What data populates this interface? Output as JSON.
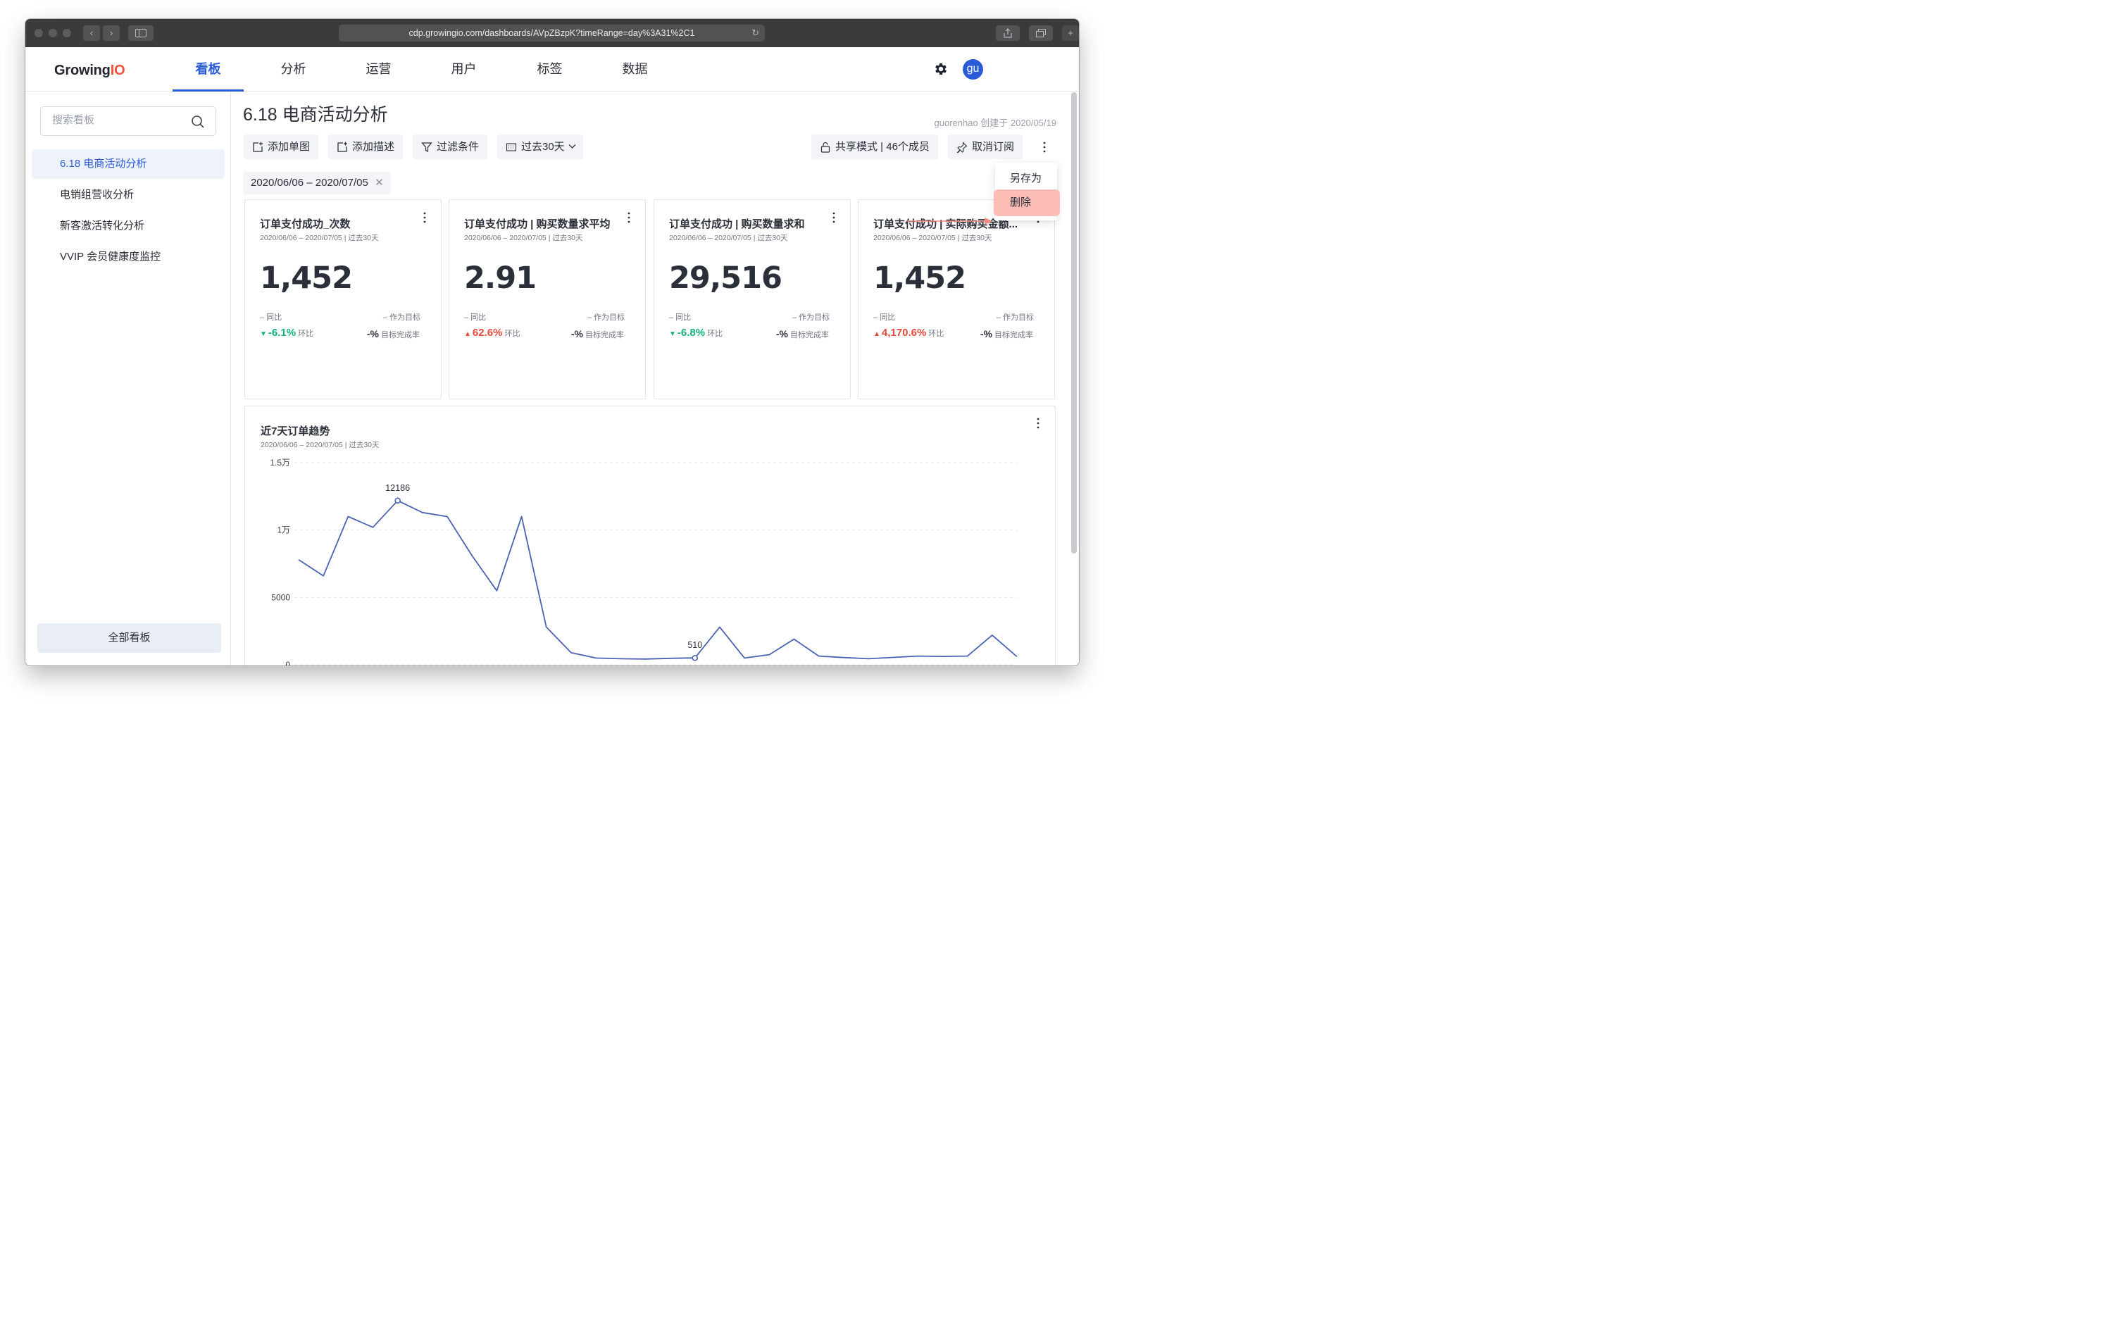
{
  "browser": {
    "url": "cdp.growingio.com/dashboards/AVpZBzpK?timeRange=day%3A31%2C1"
  },
  "header": {
    "logo_main": "Growing",
    "logo_accent": "IO",
    "nav": [
      {
        "label": "看板",
        "active": true
      },
      {
        "label": "分析",
        "active": false
      },
      {
        "label": "运营",
        "active": false
      },
      {
        "label": "用户",
        "active": false
      },
      {
        "label": "标签",
        "active": false
      },
      {
        "label": "数据",
        "active": false
      }
    ],
    "avatar_text": "gu",
    "accent_color": "#2a5bd7"
  },
  "sidebar": {
    "search_placeholder": "搜索看板",
    "items": [
      {
        "label": "6.18 电商活动分析",
        "active": true
      },
      {
        "label": "电销组营收分析",
        "active": false
      },
      {
        "label": "新客激活转化分析",
        "active": false
      },
      {
        "label": "VVIP 会员健康度监控",
        "active": false
      }
    ],
    "all_boards_label": "全部看板"
  },
  "dashboard": {
    "title": "6.18 电商活动分析",
    "creator": "guorenhao 创建于 2020/05/19",
    "toolbar": {
      "add_chart": "添加单图",
      "add_desc": "添加描述",
      "filter": "过滤条件",
      "time_range": "过去30天",
      "share_mode": "共享模式 | 46个成员",
      "unsubscribe": "取消订阅"
    },
    "date_chip": "2020/06/06 – 2020/07/05",
    "menu": {
      "save_as": "另存为",
      "delete": "删除"
    }
  },
  "cards": [
    {
      "title": "订单支付成功_次数",
      "range": "2020/06/06 – 2020/07/05 | 过去30天",
      "value": "1,452",
      "yoy": "– 同比",
      "goal": "– 作为目标",
      "mom_pct": "-6.1%",
      "mom_dir": "down",
      "mom_label": "环比",
      "rate": "-%",
      "rate_label": "目标完成率"
    },
    {
      "title": "订单支付成功 | 购买数量求平均",
      "range": "2020/06/06 – 2020/07/05 | 过去30天",
      "value": "2.91",
      "yoy": "– 同比",
      "goal": "– 作为目标",
      "mom_pct": "62.6%",
      "mom_dir": "up",
      "mom_label": "环比",
      "rate": "-%",
      "rate_label": "目标完成率"
    },
    {
      "title": "订单支付成功 | 购买数量求和",
      "range": "2020/06/06 – 2020/07/05 | 过去30天",
      "value": "29,516",
      "yoy": "– 同比",
      "goal": "– 作为目标",
      "mom_pct": "-6.8%",
      "mom_dir": "down",
      "mom_label": "环比",
      "rate": "-%",
      "rate_label": "目标完成率"
    },
    {
      "title": "订单支付成功 | 实际购买金额...",
      "range": "2020/06/06 – 2020/07/05 | 过去30天",
      "value": "1,452",
      "yoy": "– 同比",
      "goal": "– 作为目标",
      "mom_pct": "4,170.6%",
      "mom_dir": "up",
      "mom_label": "环比",
      "rate": "-%",
      "rate_label": "目标完成率"
    }
  ],
  "trend": {
    "title": "近7天订单趋势",
    "range": "2020/06/06 – 2020/07/05 | 过去30天"
  },
  "chart_data": {
    "type": "line",
    "title": "近7天订单趋势",
    "xlabel": "",
    "ylabel": "",
    "ylim": [
      0,
      15000
    ],
    "y_ticks": [
      {
        "value": 15000,
        "label": "1.5万"
      },
      {
        "value": 10000,
        "label": "1万"
      },
      {
        "value": 5000,
        "label": "5000"
      },
      {
        "value": 0,
        "label": "0"
      }
    ],
    "grid": true,
    "line_color": "#4a62b3",
    "series": [
      {
        "values": [
          7800,
          6600,
          11000,
          10200,
          12186,
          11300,
          11000,
          8100,
          5500,
          11000,
          2800,
          900,
          500,
          450,
          430,
          480,
          510,
          2800,
          500,
          750,
          1900,
          650,
          540,
          450,
          550,
          650,
          620,
          650,
          2200,
          600
        ]
      }
    ],
    "annotations": [
      {
        "index": 4,
        "label": "12186"
      },
      {
        "index": 16,
        "label": "510"
      }
    ]
  }
}
